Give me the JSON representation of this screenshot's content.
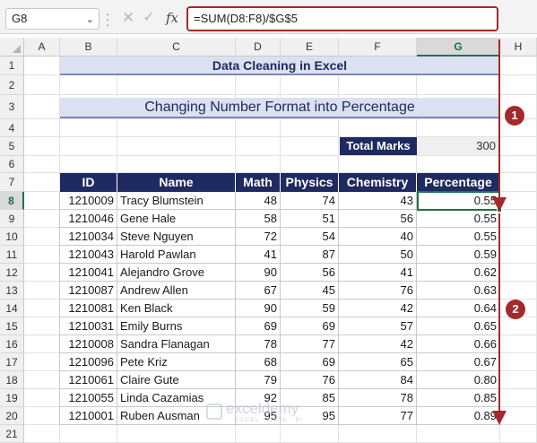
{
  "formula_bar": {
    "name_box": "G8",
    "cancel_icon": "close-icon",
    "enter_icon": "check-icon",
    "fx_label": "fx",
    "formula": "=SUM(D8:F8)/$G$5"
  },
  "columns": [
    "A",
    "B",
    "C",
    "D",
    "E",
    "F",
    "G",
    "H"
  ],
  "rows": [
    "1",
    "2",
    "3",
    "4",
    "5",
    "6",
    "7",
    "8",
    "9",
    "10",
    "11",
    "12",
    "13",
    "14",
    "15",
    "16",
    "17",
    "18",
    "19",
    "20",
    "21"
  ],
  "selected_cell": {
    "column": "G",
    "row": "8"
  },
  "sheet": {
    "title": "Data Cleaning in Excel",
    "subtitle": "Changing Number Format into Percentage",
    "total_marks_label": "Total Marks",
    "total_marks_value": "300",
    "headers": [
      "ID",
      "Name",
      "Math",
      "Physics",
      "Chemistry",
      "Percentage"
    ],
    "records": [
      [
        "1210009",
        "Tracy Blumstein",
        "48",
        "74",
        "43",
        "0.55"
      ],
      [
        "1210046",
        "Gene Hale",
        "58",
        "51",
        "56",
        "0.55"
      ],
      [
        "1210034",
        "Steve Nguyen",
        "72",
        "54",
        "40",
        "0.55"
      ],
      [
        "1210043",
        "Harold Pawlan",
        "41",
        "87",
        "50",
        "0.59"
      ],
      [
        "1210041",
        "Alejandro Grove",
        "90",
        "56",
        "41",
        "0.62"
      ],
      [
        "1210087",
        "Andrew Allen",
        "67",
        "45",
        "76",
        "0.63"
      ],
      [
        "1210081",
        "Ken Black",
        "90",
        "59",
        "42",
        "0.64"
      ],
      [
        "1210031",
        "Emily Burns",
        "69",
        "69",
        "57",
        "0.65"
      ],
      [
        "1210008",
        "Sandra Flanagan",
        "78",
        "77",
        "42",
        "0.66"
      ],
      [
        "1210096",
        "Pete Kriz",
        "68",
        "69",
        "65",
        "0.67"
      ],
      [
        "1210061",
        "Claire Gute",
        "79",
        "76",
        "84",
        "0.80"
      ],
      [
        "1210055",
        "Linda Cazamias",
        "92",
        "85",
        "78",
        "0.85"
      ],
      [
        "1210001",
        "Ruben Ausman",
        "95",
        "95",
        "77",
        "0.89"
      ]
    ]
  },
  "annotations": {
    "badge_1": "1",
    "badge_2": "2",
    "arrow_color": "#a32a2a"
  },
  "watermark": {
    "name": "exceldemy",
    "tagline": "EXCEL · DATA · BI"
  },
  "colors": {
    "header_fill": "#1f2a60",
    "title_fill": "#dbe1f0",
    "selection": "#217346",
    "annotation": "#a32a2a"
  }
}
